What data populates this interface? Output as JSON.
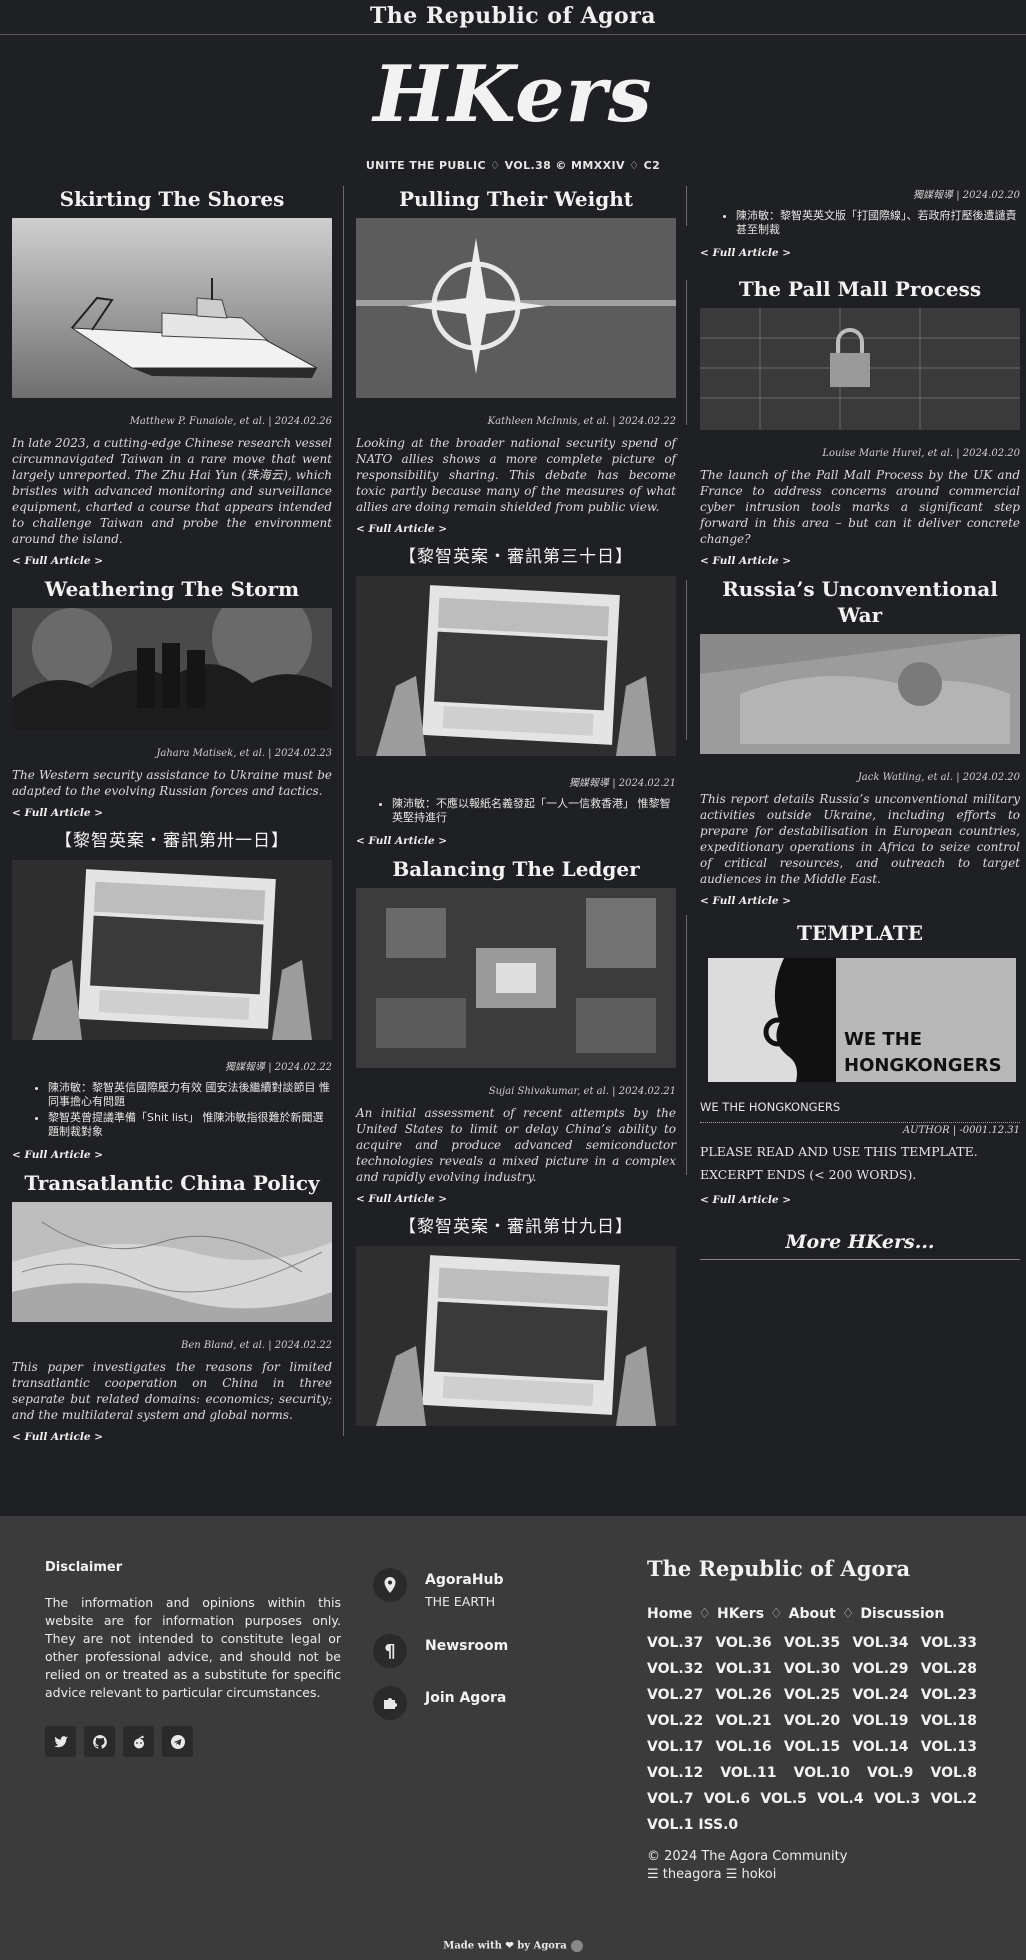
{
  "site": {
    "title": "The Republic of Agora",
    "logo": "HKers",
    "edition": "UNITE THE PUBLIC ♢ VOL.38 © MMXXIV ♢ C2"
  },
  "articles": {
    "skirting": {
      "title": "Skirting The Shores",
      "byline": "Matthew P. Funaiole, et al. | 2024.02.26",
      "summary": "In late 2023, a cutting-edge Chinese research vessel circumnavigated Taiwan in a rare move that went largely unreported. The Zhu Hai Yun (珠海云), which bristles with advanced monitoring and surveillance equipment, charted a course that appears intended to challenge Taiwan and probe the environment around the island."
    },
    "weathering": {
      "title": "Weathering The Storm",
      "byline": "Jahara Matisek, et al. | 2024.02.23",
      "summary": "The Western security assistance to Ukraine must be adapted to the evolving Russian forces and tactics."
    },
    "trial31": {
      "title": "【黎智英案・審訊第卅一日】",
      "byline": "獨媒報導 | 2024.02.22",
      "bullets": [
        "陳沛敏：黎智英信國際壓力有效 國安法後繼續對談節目 惟同事擔心有問題",
        "黎智英曾提議準備「Shit list」 惟陳沛敏指很難於新聞選題制裁對象"
      ]
    },
    "transatlantic": {
      "title": "Transatlantic China Policy",
      "byline": "Ben Bland, et al. | 2024.02.22",
      "summary": "This paper investigates the reasons for limited transatlantic cooperation on China in three separate but related domains: economics; security; and the multilateral system and global norms."
    },
    "pulling": {
      "title": "Pulling Their Weight",
      "byline": "Kathleen McInnis, et al. | 2024.02.22",
      "summary": "Looking at the broader national security spend of NATO allies shows a more complete picture of responsibility sharing. This debate has become toxic partly because many of the measures of what allies are doing remain shielded from public view."
    },
    "trial30": {
      "title": "【黎智英案・審訊第三十日】",
      "byline": "獨媒報導 | 2024.02.21",
      "bullets": [
        "陳沛敏：不應以報紙名義發起「一人一信救香港」 惟黎智英堅持進行"
      ]
    },
    "balancing": {
      "title": "Balancing The Ledger",
      "byline": "Sujai Shivakumar, et al. | 2024.02.21",
      "summary": "An initial assessment of recent attempts by the United States to limit or delay China’s ability to acquire and produce advanced semiconductor technologies reveals a mixed picture in a complex and rapidly evolving industry."
    },
    "trial29": {
      "title": "【黎智英案・審訊第廿九日】"
    },
    "trial28": {
      "byline": "獨媒報導 | 2024.02.20",
      "bullets": [
        "陳沛敏：黎智英英文版「打國際線」、若政府打壓後遭譴責甚至制裁"
      ]
    },
    "pallmall": {
      "title": "The Pall Mall Process",
      "byline": "Louise Marie Hurel, et al. | 2024.02.20",
      "summary": "The launch of the Pall Mall Process by the UK and France to address concerns around commercial cyber intrusion tools marks a significant step forward in this area – but can it deliver concrete change?"
    },
    "russia": {
      "title": "Russia’s Unconventional War",
      "byline": "Jack Watling, et al. | 2024.02.20",
      "summary": "This report details Russia’s unconventional military activities outside Ukraine, including efforts to prepare for destabilisation in European countries, expeditionary operations in Africa to seize control of critical resources, and outreach to target audiences in the Middle East."
    },
    "template": {
      "title": "TEMPLATE",
      "logo_line1": "WE THE",
      "logo_line2": "HONGKONGERS",
      "caption": "WE THE HONGKONGERS",
      "byline": "AUTHOR | -0001.12.31",
      "body_line1": "PLEASE READ AND USE THIS TEMPLATE.",
      "body_line2": "EXCERPT ENDS (< 200 WORDS)."
    }
  },
  "labels": {
    "full_article": "< Full Article >",
    "more_hkers": "More HKers..."
  },
  "footer": {
    "disclaimer_title": "Disclaimer",
    "disclaimer_text": "The information and opinions within this website are for information purposes only. They are not intended to constitute legal or other professional advice, and should not be relied on or treated as a substitute for specific advice relevant to particular circumstances.",
    "socials": [
      "twitter-icon",
      "github-icon",
      "reddit-icon",
      "telegram-icon"
    ],
    "hub_title": "AgoraHub",
    "hub_sub": "THE EARTH",
    "newsroom": "Newsroom",
    "join": "Join Agora",
    "brand": "The Republic of Agora",
    "nav": [
      "Home",
      "HKers",
      "About",
      "Discussion"
    ],
    "nav_sep": "♢",
    "vol_rows": [
      [
        "VOL.37",
        "VOL.36",
        "VOL.35",
        "VOL.34",
        "VOL.33"
      ],
      [
        "VOL.32",
        "VOL.31",
        "VOL.30",
        "VOL.29",
        "VOL.28"
      ],
      [
        "VOL.27",
        "VOL.26",
        "VOL.25",
        "VOL.24",
        "VOL.23"
      ],
      [
        "VOL.22",
        "VOL.21",
        "VOL.20",
        "VOL.19",
        "VOL.18"
      ],
      [
        "VOL.17",
        "VOL.16",
        "VOL.15",
        "VOL.14",
        "VOL.13"
      ],
      [
        "VOL.12",
        "VOL.11",
        "VOL.10",
        "VOL.9",
        "VOL.8"
      ],
      [
        "VOL.7",
        "VOL.6",
        "VOL.5",
        "VOL.4",
        "VOL.3",
        "VOL.2"
      ],
      [
        "VOL.1 ISS.0"
      ]
    ],
    "copyright": "© 2024 The Agora Community",
    "credits": "☰ theagora ☰ hokoi",
    "made_with": "Made with ❤ by Agora"
  }
}
